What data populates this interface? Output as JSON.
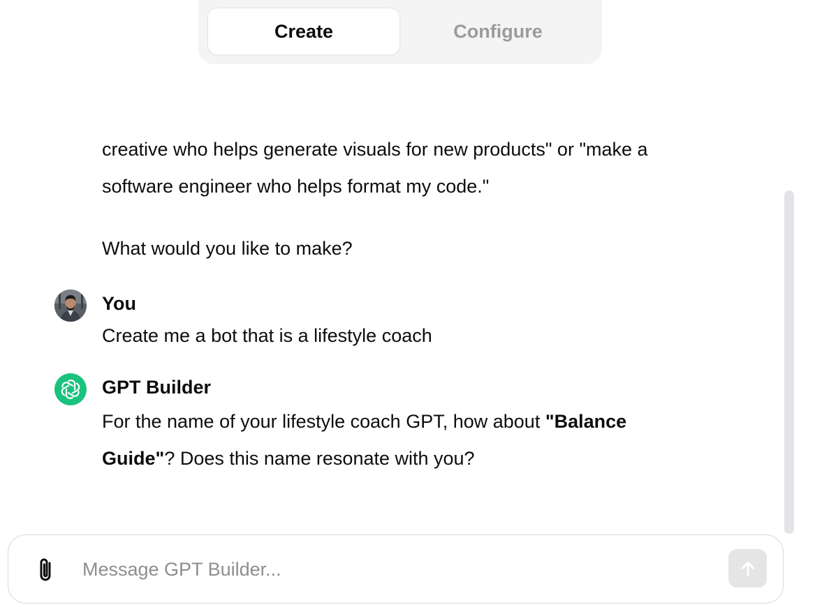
{
  "tabs": {
    "create_label": "Create",
    "configure_label": "Configure",
    "active": "Create"
  },
  "conversation": {
    "intro_line1": "creative who helps generate visuals for new products\" or \"make a",
    "intro_line2": "software engineer who helps format my code.\"",
    "intro_question": "What would you like to make?",
    "user": {
      "name": "You",
      "message": "Create me a bot that is a lifestyle coach"
    },
    "assistant": {
      "name": "GPT Builder",
      "message_part1": "For the name of your lifestyle coach GPT, how about ",
      "message_bold1": "\"Balance",
      "message_bold2": "Guide\"",
      "message_part2": "? Does this name resonate with you?"
    }
  },
  "composer": {
    "placeholder": "Message GPT Builder...",
    "value": "",
    "attach_icon": "paperclip-icon",
    "send_icon": "arrow-up-icon"
  },
  "colors": {
    "brand_green": "#19c37d",
    "send_disabled": "#e5e5e5",
    "tab_inactive_text": "#9b9b9b"
  }
}
